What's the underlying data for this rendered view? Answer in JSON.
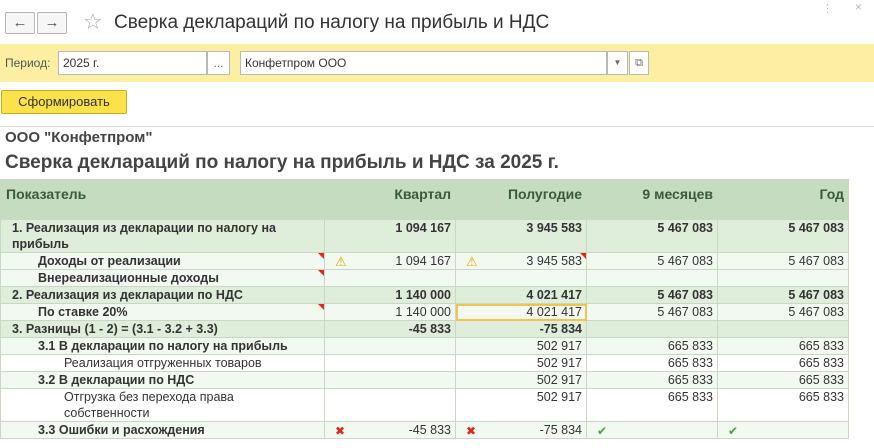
{
  "window": {
    "title": "Сверка деклараций по налогу на прибыль и НДС",
    "back_icon": "←",
    "forward_icon": "→",
    "star_icon": "☆",
    "more_icon": "⋮",
    "close_icon": "×"
  },
  "filters": {
    "period_label": "Период:",
    "period_value": "2025 г.",
    "period_button": "...",
    "org_value": "Конфетпром ООО",
    "org_drop_icon": "▼",
    "org_open_icon": "⧉"
  },
  "actions": {
    "generate_label": "Сформировать"
  },
  "report": {
    "org_name": "ООО \"Конфетпром\"",
    "title": "Сверка деклараций по налогу на прибыль и НДС за 2025 г.",
    "columns": [
      "Показатель",
      "Квартал",
      "Полугодие",
      "9 месяцев",
      "Год"
    ],
    "rows": [
      {
        "label": "1. Реализация из декларации по налогу на прибыль",
        "q": "1 094 167",
        "h": "3 945 583",
        "m9": "5 467 083",
        "y": "5 467 083"
      },
      {
        "label": "Доходы от реализации",
        "q": "1 094 167",
        "h": "3 945 583",
        "m9": "5 467 083",
        "y": "5 467 083"
      },
      {
        "label": "Внереализационные доходы",
        "q": "",
        "h": "",
        "m9": "",
        "y": ""
      },
      {
        "label": "2. Реализация из декларации по НДС",
        "q": "1 140 000",
        "h": "4 021 417",
        "m9": "5 467 083",
        "y": "5 467 083"
      },
      {
        "label": "По ставке 20%",
        "q": "1 140 000",
        "h": "4 021 417",
        "m9": "5 467 083",
        "y": "5 467 083"
      },
      {
        "label": "3. Разницы (1 - 2) = (3.1 - 3.2 + 3.3)",
        "q": "-45 833",
        "h": "-75 834",
        "m9": "",
        "y": ""
      },
      {
        "label": "3.1 В декларации по налогу на прибыль",
        "q": "",
        "h": "502 917",
        "m9": "665 833",
        "y": "665 833"
      },
      {
        "label": "Реализация отгруженных товаров",
        "q": "",
        "h": "502 917",
        "m9": "665 833",
        "y": "665 833"
      },
      {
        "label": "3.2 В декларации по НДС",
        "q": "",
        "h": "502 917",
        "m9": "665 833",
        "y": "665 833"
      },
      {
        "label": "Отгрузка без перехода права собственности",
        "q": "",
        "h": "502 917",
        "m9": "665 833",
        "y": "665 833"
      },
      {
        "label": "3.3 Ошибки и расхождения",
        "q": "-45 833",
        "h": "-75 834",
        "m9": "",
        "y": ""
      }
    ]
  },
  "icons": {
    "warning": "⚠",
    "error": "✖",
    "ok": "✔"
  },
  "colors": {
    "filter_bg": "#fcefa1",
    "header_bg": "#c5dcc1",
    "accent_button": "#fbe24b",
    "marker_red": "#e0261d"
  }
}
